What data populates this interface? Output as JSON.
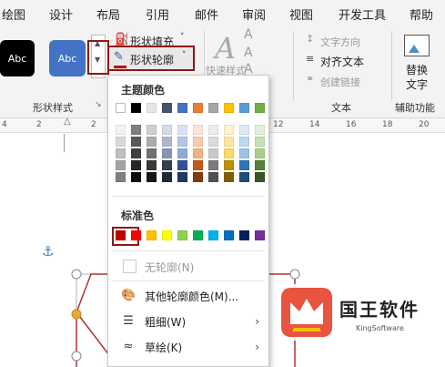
{
  "tabs": [
    "绘图",
    "设计",
    "布局",
    "引用",
    "邮件",
    "审阅",
    "视图",
    "开发工具",
    "帮助"
  ],
  "ribbon": {
    "style_thumbs": [
      {
        "label": "Abc",
        "color": "#000000"
      },
      {
        "label": "Abc",
        "color": "#4472c4"
      }
    ],
    "shape_fill": "形状填充",
    "shape_outline": "形状轮廓",
    "shape_styles_group": "形状样式",
    "quick_styles": "快速样式",
    "text_direction": "文字方向",
    "align_text": "对齐文本",
    "create_link": "创建链接",
    "text_group": "文本",
    "replace_text": [
      "替换",
      "文字"
    ],
    "accessibility_group": "辅助功能"
  },
  "ruler": {
    "marks": [
      "4",
      "2",
      "2",
      "4",
      "6",
      "8",
      "10",
      "12",
      "14",
      "16",
      "18",
      "20"
    ]
  },
  "dropdown": {
    "theme_colors_title": "主题颜色",
    "theme_top_row": [
      "#ffffff",
      "#000000",
      "#e7e6e6",
      "#44546a",
      "#4472c4",
      "#ed7d31",
      "#a5a5a5",
      "#ffc000",
      "#5b9bd5",
      "#70ad47"
    ],
    "theme_shades": [
      [
        "#f2f2f2",
        "#7f7f7f",
        "#d0cece",
        "#d6dce4",
        "#d9e2f3",
        "#fbe5d5",
        "#ededed",
        "#fff2cc",
        "#deebf6",
        "#e2efd9"
      ],
      [
        "#d8d8d8",
        "#595959",
        "#aeabab",
        "#adb9ca",
        "#b4c6e7",
        "#f7cbac",
        "#dbdbdb",
        "#fee599",
        "#bdd7ee",
        "#c5e0b3"
      ],
      [
        "#bfbfbf",
        "#3f3f3f",
        "#757070",
        "#8496b0",
        "#8eaadb",
        "#f4b183",
        "#c9c9c9",
        "#ffd965",
        "#9cc3e5",
        "#a8d08d"
      ],
      [
        "#a5a5a5",
        "#262626",
        "#3a3838",
        "#323f4f",
        "#2f5496",
        "#c55a11",
        "#7b7b7b",
        "#bf9000",
        "#2e75b5",
        "#538135"
      ],
      [
        "#7f7f7f",
        "#0c0c0c",
        "#171616",
        "#222a35",
        "#1f3864",
        "#833c0b",
        "#525252",
        "#7f6000",
        "#1e4e79",
        "#375623"
      ]
    ],
    "standard_colors_title": "标准色",
    "standard_colors": [
      "#c00000",
      "#ff0000",
      "#ffc000",
      "#ffff00",
      "#92d050",
      "#00b050",
      "#00b0f0",
      "#0070c0",
      "#002060",
      "#7030a0"
    ],
    "no_outline": "无轮廓(N)",
    "more_colors": "其他轮廓颜色(M)...",
    "weight": "粗细(W)",
    "sketched": "草绘(K)"
  },
  "logo": {
    "name": "国王软件",
    "sub": "KingSoftware"
  },
  "colors": {
    "highlight_box": "#8b1a1a",
    "shape_line": "#b03030",
    "handle": "#e8a93a"
  }
}
